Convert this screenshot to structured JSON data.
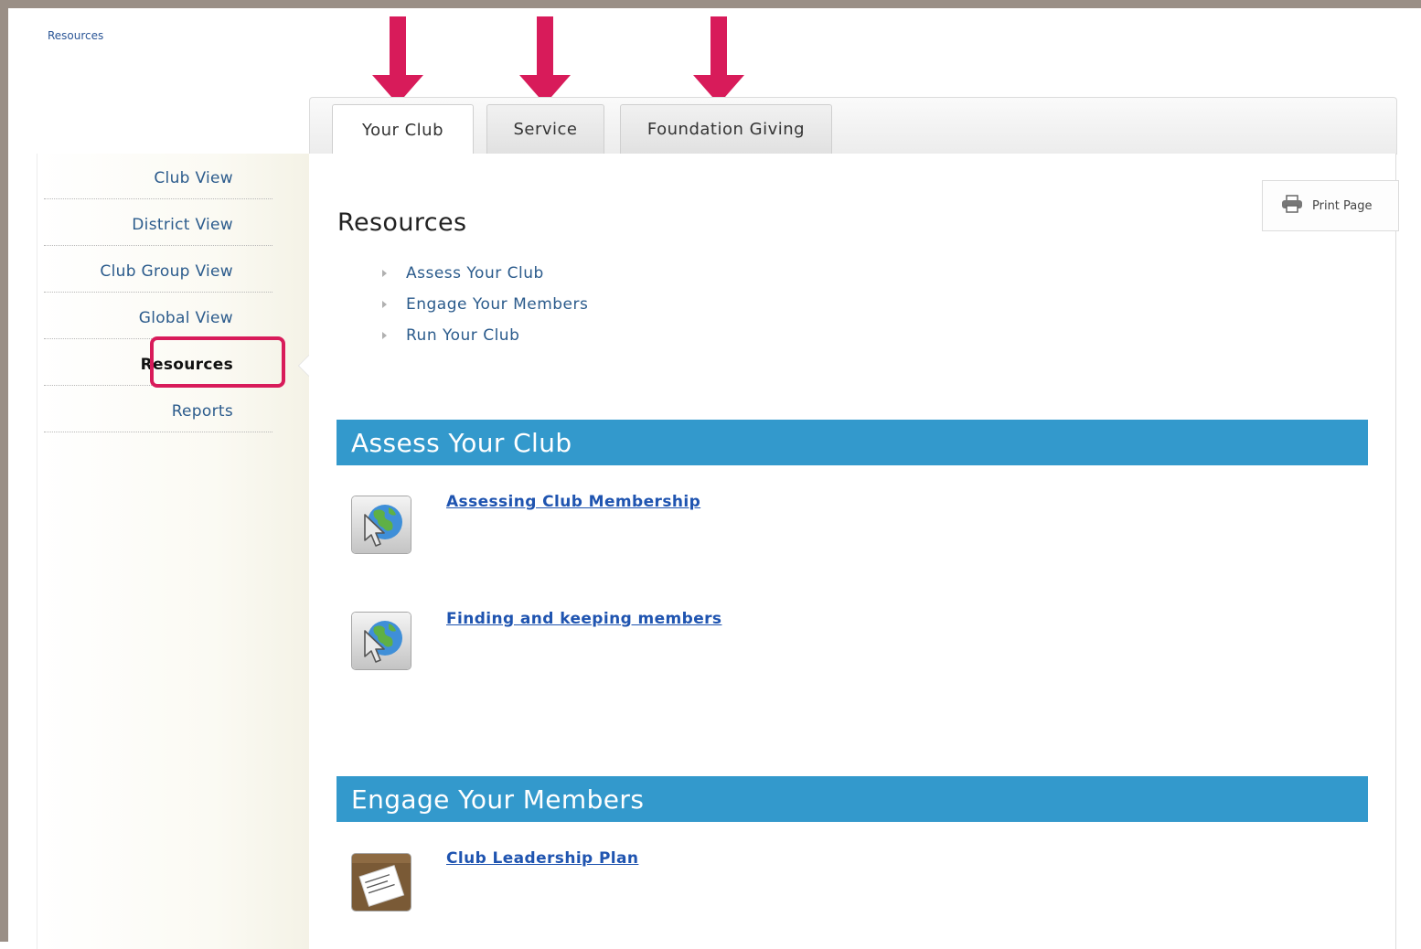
{
  "breadcrumb": "Resources",
  "tabs": [
    {
      "label": "Your Club",
      "active": true
    },
    {
      "label": "Service",
      "active": false
    },
    {
      "label": "Foundation Giving",
      "active": false
    }
  ],
  "sidebar": {
    "items": [
      {
        "label": "Club View"
      },
      {
        "label": "District View"
      },
      {
        "label": "Club Group View"
      },
      {
        "label": "Global View"
      },
      {
        "label": "Resources",
        "active": true
      },
      {
        "label": "Reports"
      }
    ]
  },
  "print_page": {
    "label": "Print Page",
    "icon": "printer-icon"
  },
  "page_title": "Resources",
  "toc": [
    {
      "label": "Assess Your Club"
    },
    {
      "label": "Engage Your Members"
    },
    {
      "label": "Run Your Club"
    }
  ],
  "sections": [
    {
      "title": "Assess Your Club",
      "links": [
        {
          "label": "Assessing Club Membership",
          "icon": "web-link-icon"
        },
        {
          "label": "Finding and keeping members",
          "icon": "web-link-icon"
        }
      ]
    },
    {
      "title": "Engage Your Members",
      "links": [
        {
          "label": "Club Leadership Plan",
          "icon": "document-icon"
        }
      ]
    }
  ],
  "colors": {
    "accent_pink": "#d81b5a",
    "section_header": "#3399cc",
    "link_blue": "#1f54b0",
    "nav_blue": "#2b5b8c",
    "frame": "#9a8f86"
  }
}
